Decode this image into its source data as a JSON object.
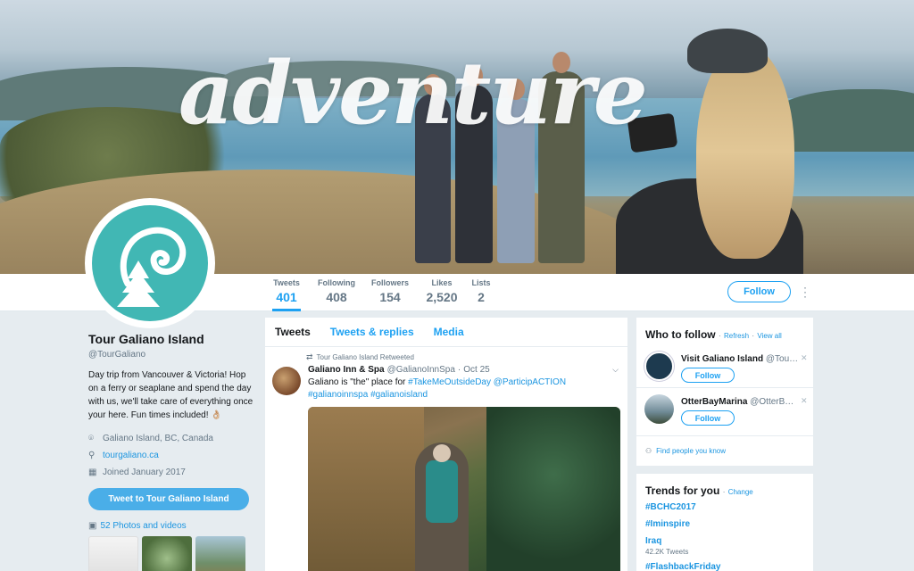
{
  "banner": {
    "headline": "adventure"
  },
  "nav": {
    "stats": [
      {
        "label": "Tweets",
        "value": "401"
      },
      {
        "label": "Following",
        "value": "408"
      },
      {
        "label": "Followers",
        "value": "154"
      },
      {
        "label": "Likes",
        "value": "2,520"
      },
      {
        "label": "Lists",
        "value": "2"
      }
    ],
    "follow_label": "Follow",
    "more_icon": "more-vertical-icon"
  },
  "profile": {
    "name": "Tour Galiano Island",
    "handle": "@TourGaliano",
    "bio": "Day trip from Vancouver & Victoria! Hop on a ferry or seaplane and spend the day with us, we'll take care of everything once your here. Fun times included! 👌🏼",
    "location": "Galiano Island, BC, Canada",
    "website": "tourgaliano.ca",
    "joined": "Joined January 2017",
    "tweet_to_label": "Tweet to Tour Galiano Island",
    "photos_label": "52 Photos and videos"
  },
  "timeline": {
    "tabs": [
      "Tweets",
      "Tweets & replies",
      "Media"
    ],
    "tweet": {
      "retweet_note": "Tour Galiano Island Retweeted",
      "author_name": "Galiano Inn & Spa",
      "author_handle": "@GalianoInnSpa",
      "separator": "·",
      "date": "Oct 25",
      "text_before": "Galiano is \"the\" place for ",
      "hashtag1": "#TakeMeOutsideDay",
      "mention": "@ParticipACTION",
      "hashtag2": "#galianoinnspa",
      "hashtag3": "#galianoisland"
    }
  },
  "who_to_follow": {
    "title": "Who to follow",
    "sep": "·",
    "refresh": "Refresh",
    "view_all": "View all",
    "suggestions": [
      {
        "name": "Visit Galiano Island",
        "handle": "@Tou…",
        "button": "Follow"
      },
      {
        "name": "OtterBayMarina",
        "handle": "@OtterB…",
        "button": "Follow"
      }
    ],
    "find_people": "Find people you know"
  },
  "trends": {
    "title": "Trends for you",
    "sep": "·",
    "change": "Change",
    "items": [
      {
        "name": "#BCHC2017",
        "sub": ""
      },
      {
        "name": "#Iminspire",
        "sub": ""
      },
      {
        "name": "Iraq",
        "sub": "42.2K Tweets"
      },
      {
        "name": "#FlashbackFriday",
        "sub": ""
      }
    ]
  },
  "colors": {
    "accent": "#1da1f2",
    "link": "#1b95e0",
    "avatar_teal": "#41b7b4",
    "background": "#e6ecf0"
  }
}
